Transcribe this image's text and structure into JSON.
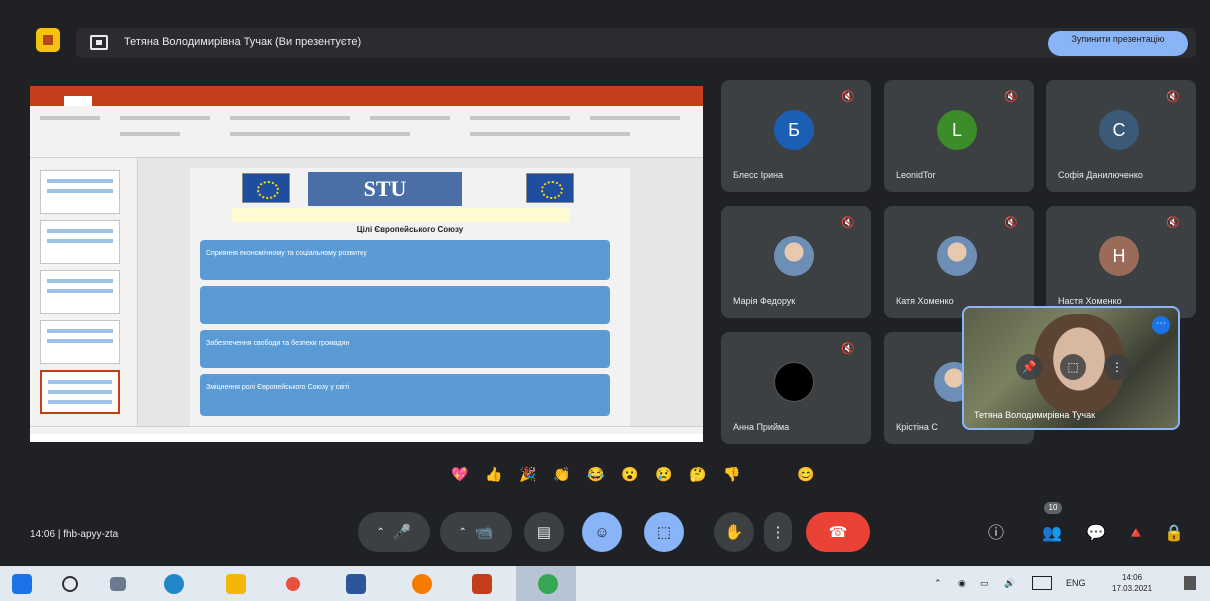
{
  "topbar": {
    "presenter_text": "Тетяна Володимирівна Тучак (Ви презентуєте)",
    "stop_button": "Зупинити презентацію"
  },
  "shared_screen": {
    "app": "PowerPoint",
    "slide_heading": "Цілі Європейського Союзу",
    "logo_text": "STU",
    "boxes": [
      "Сприяння економічному та соціальному розвитку",
      "",
      "Забезпечення свободи та безпеки громадян",
      "Зміцнення ролі Європейського Союзу у світі"
    ]
  },
  "participants": [
    {
      "name": "Блесс Ірина",
      "initial": "Б",
      "color": "#1a5fb4"
    },
    {
      "name": "LeonidTor",
      "initial": "L",
      "color": "#3c8c2a"
    },
    {
      "name": "Софія Данилюченко",
      "initial": "С",
      "color": "#3a5a78"
    },
    {
      "name": "Марія Федорук",
      "initial": "",
      "color": ""
    },
    {
      "name": "Катя Хоменко",
      "initial": "",
      "color": ""
    },
    {
      "name": "Настя Хоменко",
      "initial": "Н",
      "color": "#9b6b5a"
    },
    {
      "name": "Анна Прийма",
      "initial": "",
      "color": "#000000"
    },
    {
      "name": "Крістіна С",
      "initial": "",
      "color": ""
    }
  ],
  "self_view": {
    "name": "Тетяна Володимирівна Тучак",
    "more_icon": "⋯"
  },
  "reactions": [
    "💖",
    "👍",
    "🎉",
    "👏",
    "😂",
    "😮",
    "😢",
    "🤔",
    "👎",
    "😊"
  ],
  "meeting": {
    "time": "14:06",
    "separator": "|",
    "code": "fhb-apyy-zta"
  },
  "toolbar_icons": {
    "mic": "🎤",
    "camera": "📹",
    "captions": "▤",
    "emoji": "☺",
    "present": "⬚",
    "hand": "✋",
    "more": "⋮",
    "hangup": "☎"
  },
  "side_icons": [
    "ⓘ",
    "👥",
    "💬",
    "🔺",
    "🔒"
  ],
  "people_count": "10",
  "taskbar": {
    "lang": "ENG",
    "clock_time": "14:06",
    "clock_date": "17.03.2021"
  }
}
